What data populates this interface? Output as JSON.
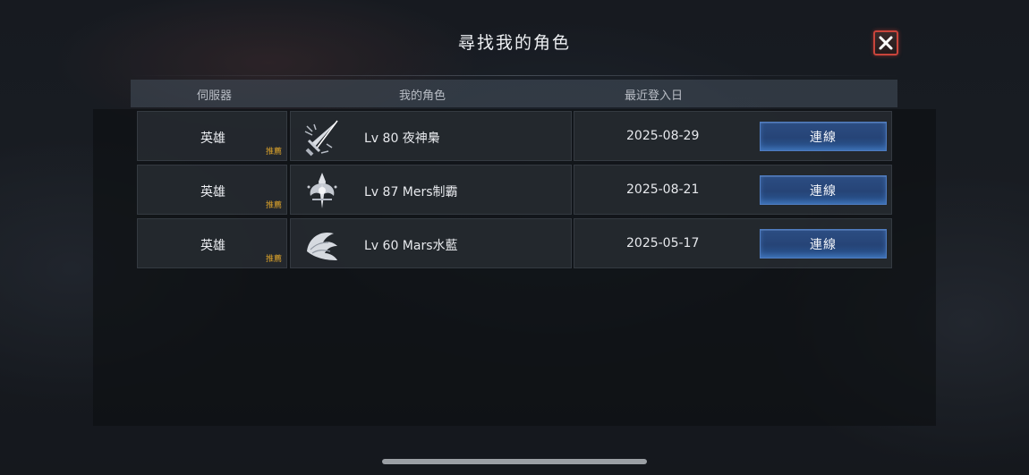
{
  "dialog": {
    "title": "尋找我的角色"
  },
  "columns": {
    "server": "伺服器",
    "character": "我的角色",
    "last_login": "最近登入日"
  },
  "rows": [
    {
      "server": "英雄",
      "tag": "推薦",
      "icon": "blade-class-icon",
      "character": "Lv 80 夜神梟",
      "last_login": "2025-08-29",
      "button": "連線"
    },
    {
      "server": "英雄",
      "tag": "推薦",
      "icon": "crest-class-icon",
      "character": "Lv 87 Mers制霸",
      "last_login": "2025-08-21",
      "button": "連線"
    },
    {
      "server": "英雄",
      "tag": "推薦",
      "icon": "wing-class-icon",
      "character": "Lv 60 Mars水藍",
      "last_login": "2025-05-17",
      "button": "連線"
    }
  ],
  "colors": {
    "close_border": "#c9443b",
    "connect_button": "#2a4a80",
    "recommend_tag": "#d9a12b"
  }
}
